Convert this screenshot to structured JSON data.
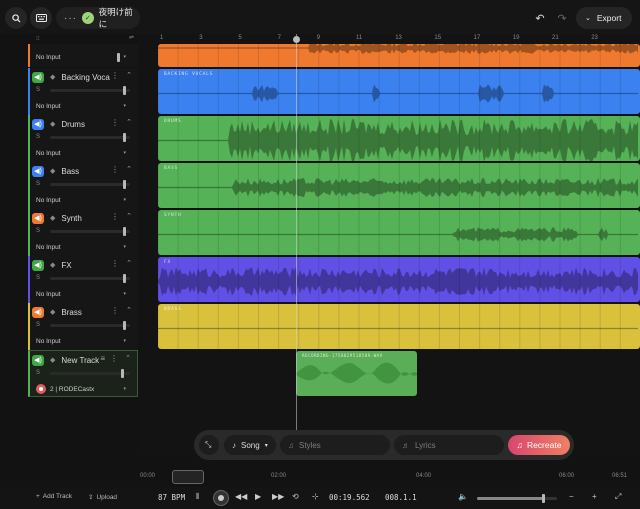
{
  "header": {
    "project_name": "夜明け前に",
    "export_label": "Export"
  },
  "tracks": [
    {
      "name": "",
      "input": "No Input",
      "color": "#ef7a2f",
      "badge_color": "#3fa845"
    },
    {
      "name": "Backing Voca",
      "input": "No Input",
      "color": "#3b82f0",
      "badge_color": "#3fa845",
      "clip_label": "BACKING VOCALS"
    },
    {
      "name": "Drums",
      "input": "No Input",
      "color": "#56b256",
      "badge_color": "#3b82f0",
      "clip_label": "DRUMS"
    },
    {
      "name": "Bass",
      "input": "No Input",
      "color": "#56b256",
      "badge_color": "#3b82f0",
      "clip_label": "BASS"
    },
    {
      "name": "Synth",
      "input": "No Input",
      "color": "#56b256",
      "badge_color": "#ef7a2f",
      "clip_label": "SYNTH"
    },
    {
      "name": "FX",
      "input": "No Input",
      "color": "#6150e6",
      "badge_color": "#3fa845",
      "clip_label": "FX"
    },
    {
      "name": "Brass",
      "input": "No Input",
      "color": "#d9c13c",
      "badge_color": "#ef7a2f",
      "clip_label": "BRASS"
    },
    {
      "name": "New Track",
      "input": "2 | RODECastx",
      "color": "#5aae58",
      "badge_color": "#3fa845"
    }
  ],
  "recording_clip_label": "RECORDING-1758829518589.WAV",
  "solo_label": "S",
  "ruler_marks": [
    "1",
    "3",
    "5",
    "7",
    "9",
    "11",
    "13",
    "15",
    "17",
    "19",
    "21",
    "23"
  ],
  "prompt": {
    "song_label": "Song",
    "styles_placeholder": "Styles",
    "lyrics_placeholder": "Lyrics",
    "recreate_label": "Recreate"
  },
  "scrub_times": [
    "00:00",
    "02:00",
    "04:00",
    "06:00",
    "06:51"
  ],
  "transport": {
    "add_track_label": "Add Track",
    "upload_label": "Upload",
    "bpm": "87 BPM",
    "time": "00:19.562",
    "position": "008.1.1"
  },
  "volume_level": 0.82
}
